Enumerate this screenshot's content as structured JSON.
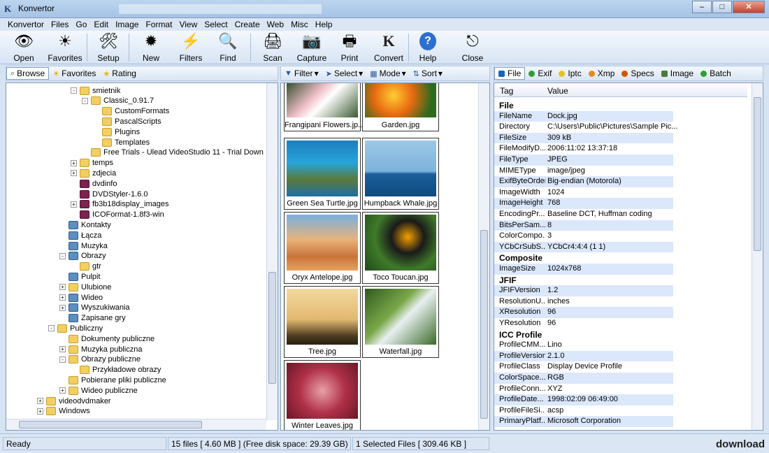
{
  "window": {
    "title": "Konvertor",
    "min": "–",
    "max": "□",
    "close": "✕"
  },
  "menu": [
    "Konvertor",
    "Files",
    "Go",
    "Edit",
    "Image",
    "Format",
    "View",
    "Select",
    "Create",
    "Web",
    "Misc",
    "Help"
  ],
  "toolbar": [
    {
      "label": "Open",
      "icon": "eye-icon",
      "glyph": "👁"
    },
    {
      "label": "Favorites",
      "icon": "sun-icon",
      "glyph": "☀"
    },
    {
      "label": "Setup",
      "icon": "setup-icon",
      "glyph": "🛠"
    },
    {
      "label": "New",
      "icon": "sunflower-icon",
      "glyph": "✹"
    },
    {
      "label": "Filters",
      "icon": "lightning-icon",
      "glyph": "⚡"
    },
    {
      "label": "Find",
      "icon": "magnifier-icon",
      "glyph": "🔍"
    },
    {
      "label": "Scan",
      "icon": "scanner-icon",
      "glyph": "🖨"
    },
    {
      "label": "Capture",
      "icon": "camera-icon",
      "glyph": "📷"
    },
    {
      "label": "Print",
      "icon": "printer-icon",
      "glyph": "🖶"
    },
    {
      "label": "Convert",
      "icon": "konvertor-logo-icon",
      "glyph": "K"
    },
    {
      "label": "Help",
      "icon": "help-icon",
      "glyph": "?"
    },
    {
      "label": "Close",
      "icon": "close-door-icon",
      "glyph": "⎋"
    }
  ],
  "left_tabs": [
    {
      "label": "Browse",
      "icon": "binoculars-icon",
      "glyph": "⌕"
    },
    {
      "label": "Favorites",
      "icon": "sun-icon",
      "glyph": "☀"
    },
    {
      "label": "Rating",
      "icon": "star-icon",
      "glyph": "★"
    }
  ],
  "mid_tabs": [
    {
      "label": "Filter",
      "icon": "funnel-icon",
      "glyph": "▼"
    },
    {
      "label": "Select",
      "icon": "cursor-icon",
      "glyph": "➤"
    },
    {
      "label": "Mode",
      "icon": "grid-icon",
      "glyph": "▦"
    },
    {
      "label": "Sort",
      "icon": "sort-icon",
      "glyph": "⇅"
    }
  ],
  "right_tabs": [
    {
      "label": "File",
      "color": "#1565c0",
      "icon": "file-icon"
    },
    {
      "label": "Exif",
      "color": "#2e9e2e",
      "icon": "exif-icon"
    },
    {
      "label": "Iptc",
      "color": "#e6c21f",
      "icon": "iptc-icon"
    },
    {
      "label": "Xmp",
      "color": "#e68a1f",
      "icon": "xmp-icon"
    },
    {
      "label": "Specs",
      "color": "#d35400",
      "icon": "specs-icon"
    },
    {
      "label": "Image",
      "color": "#4a7b3a",
      "icon": "image-icon"
    },
    {
      "label": "Batch",
      "color": "#2e9e2e",
      "icon": "batch-icon"
    }
  ],
  "tree": [
    {
      "label": "smietnik",
      "indent": 6,
      "exp": "-",
      "type": "folder"
    },
    {
      "label": "Classic_0.91.7",
      "indent": 7,
      "exp": "-",
      "type": "folder"
    },
    {
      "label": "CustomFormats",
      "indent": 8,
      "exp": "",
      "type": "folder"
    },
    {
      "label": "PascalScripts",
      "indent": 8,
      "exp": "",
      "type": "folder"
    },
    {
      "label": "Plugins",
      "indent": 8,
      "exp": "",
      "type": "folder"
    },
    {
      "label": "Templates",
      "indent": 8,
      "exp": "",
      "type": "folder"
    },
    {
      "label": "Free Trials - Ulead VideoStudio 11 - Trial Down",
      "indent": 7,
      "exp": "",
      "type": "folder"
    },
    {
      "label": "temps",
      "indent": 6,
      "exp": "+",
      "type": "folder"
    },
    {
      "label": "zdjecia",
      "indent": 6,
      "exp": "+",
      "type": "folder"
    },
    {
      "label": "dvdinfo",
      "indent": 6,
      "exp": "",
      "type": "book"
    },
    {
      "label": "DVDStyler-1.6.0",
      "indent": 6,
      "exp": "",
      "type": "book"
    },
    {
      "label": "fb3b18display_images",
      "indent": 6,
      "exp": "+",
      "type": "book"
    },
    {
      "label": "ICOFormat-1.8f3-win",
      "indent": 6,
      "exp": "",
      "type": "book"
    },
    {
      "label": "Kontakty",
      "indent": 5,
      "exp": "",
      "type": "sys"
    },
    {
      "label": "Łącza",
      "indent": 5,
      "exp": "",
      "type": "sys"
    },
    {
      "label": "Muzyka",
      "indent": 5,
      "exp": "",
      "type": "sys"
    },
    {
      "label": "Obrazy",
      "indent": 5,
      "exp": "-",
      "type": "sys"
    },
    {
      "label": "gtr",
      "indent": 6,
      "exp": "",
      "type": "folder"
    },
    {
      "label": "Pulpit",
      "indent": 5,
      "exp": "",
      "type": "sys"
    },
    {
      "label": "Ulubione",
      "indent": 5,
      "exp": "+",
      "type": "folder"
    },
    {
      "label": "Wideo",
      "indent": 5,
      "exp": "+",
      "type": "sys"
    },
    {
      "label": "Wyszukiwania",
      "indent": 5,
      "exp": "+",
      "type": "sys"
    },
    {
      "label": "Zapisane gry",
      "indent": 5,
      "exp": "",
      "type": "sys"
    },
    {
      "label": "Publiczny",
      "indent": 4,
      "exp": "-",
      "type": "folder"
    },
    {
      "label": "Dokumenty publiczne",
      "indent": 5,
      "exp": "",
      "type": "folder"
    },
    {
      "label": "Muzyka publiczna",
      "indent": 5,
      "exp": "+",
      "type": "folder"
    },
    {
      "label": "Obrazy publiczne",
      "indent": 5,
      "exp": "-",
      "type": "folder"
    },
    {
      "label": "Przykładowe obrazy",
      "indent": 6,
      "exp": "",
      "type": "folder"
    },
    {
      "label": "Pobierane pliki publiczne",
      "indent": 5,
      "exp": "",
      "type": "folder"
    },
    {
      "label": "Wideo publiczne",
      "indent": 5,
      "exp": "+",
      "type": "folder"
    },
    {
      "label": "videodvdmaker",
      "indent": 3,
      "exp": "+",
      "type": "folder"
    },
    {
      "label": "Windows",
      "indent": 3,
      "exp": "+",
      "type": "folder"
    }
  ],
  "thumbnails": [
    {
      "caption": "Frangipani Flowers.jp...",
      "bg": "linear-gradient(135deg,#2f4a2a,#f0c0c8 40%,#fff 55%,#3a5a30)"
    },
    {
      "caption": "Garden.jpg",
      "bg": "radial-gradient(circle at 40% 40%,#ffcc33,#e86a10 40%,#2e6b1e 80%)"
    },
    {
      "caption": "Green Sea Turtle.jpg",
      "bg": "linear-gradient(#1d7fbf,#27a4d8 40%,#5a7a3a 70%,#1d6fa8)"
    },
    {
      "caption": "Humpback Whale.jpg",
      "bg": "linear-gradient(#9ec8e6,#7cb3dc 55%,#1b5f99 60%,#0f4a80)"
    },
    {
      "caption": "Oryx Antelope.jpg",
      "bg": "linear-gradient(#7ab0e0,#e8b27a 45%,#c9733a 75%,#e7a25e)"
    },
    {
      "caption": "Toco Toucan.jpg",
      "bg": "radial-gradient(circle at 60% 40%,#f4a000,#1a1a1a 30%,#3f7a2a 60%,#1f4a18)"
    },
    {
      "caption": "Tree.jpg",
      "bg": "linear-gradient(#f4d9a0,#e2b870 55%,#4a3a20 85%,#2b2010)"
    },
    {
      "caption": "Waterfall.jpg",
      "bg": "linear-gradient(135deg,#2f5a1e,#7aa84a 40%,#e8f0f0 55%,#3b6b2a)"
    },
    {
      "caption": "Winter Leaves.jpg",
      "bg": "radial-gradient(circle,#e8a0a8,#b03048 50%,#6a1828)"
    }
  ],
  "props_header": {
    "tag": "Tag",
    "value": "Value"
  },
  "props": [
    {
      "tag": "File",
      "value": "",
      "group": true
    },
    {
      "tag": "FileName",
      "value": "Dock.jpg"
    },
    {
      "tag": "Directory",
      "value": "C:\\Users\\Public\\Pictures\\Sample Pic..."
    },
    {
      "tag": "FileSize",
      "value": "309 kB"
    },
    {
      "tag": "FileModifyD...",
      "value": "2006:11:02 13:37:18"
    },
    {
      "tag": "FileType",
      "value": "JPEG"
    },
    {
      "tag": "MIMEType",
      "value": "image/jpeg"
    },
    {
      "tag": "ExifByteOrder",
      "value": "Big-endian (Motorola)"
    },
    {
      "tag": "ImageWidth",
      "value": "1024"
    },
    {
      "tag": "ImageHeight",
      "value": "768"
    },
    {
      "tag": "EncodingPr...",
      "value": "Baseline DCT, Huffman coding"
    },
    {
      "tag": "BitsPerSam...",
      "value": "8"
    },
    {
      "tag": "ColorCompo...",
      "value": "3"
    },
    {
      "tag": "YCbCrSubS...",
      "value": "YCbCr4:4:4 (1 1)"
    },
    {
      "tag": "Composite",
      "value": "",
      "group": true
    },
    {
      "tag": "ImageSize",
      "value": "1024x768"
    },
    {
      "tag": "JFIF",
      "value": "",
      "group": true
    },
    {
      "tag": "JFIFVersion",
      "value": "1.2"
    },
    {
      "tag": "ResolutionU...",
      "value": "inches"
    },
    {
      "tag": "XResolution",
      "value": "96"
    },
    {
      "tag": "YResolution",
      "value": "96"
    },
    {
      "tag": "ICC Profile",
      "value": "",
      "group": true
    },
    {
      "tag": "ProfileCMM...",
      "value": "Lino"
    },
    {
      "tag": "ProfileVersion",
      "value": "2.1.0"
    },
    {
      "tag": "ProfileClass",
      "value": "Display Device Profile"
    },
    {
      "tag": "ColorSpace...",
      "value": "RGB"
    },
    {
      "tag": "ProfileConn...",
      "value": "XYZ"
    },
    {
      "tag": "ProfileDate...",
      "value": "1998:02:09 06:49:00"
    },
    {
      "tag": "ProfileFileSi...",
      "value": "acsp"
    },
    {
      "tag": "PrimaryPlatf...",
      "value": "Microsoft Corporation"
    }
  ],
  "status": {
    "ready": "Ready",
    "files": "15 files [ 4.60 MB ]  (Free disk space: 29.39 GB)",
    "selected": "1 Selected Files  [ 309.46 KB ]",
    "watermark": "download"
  }
}
